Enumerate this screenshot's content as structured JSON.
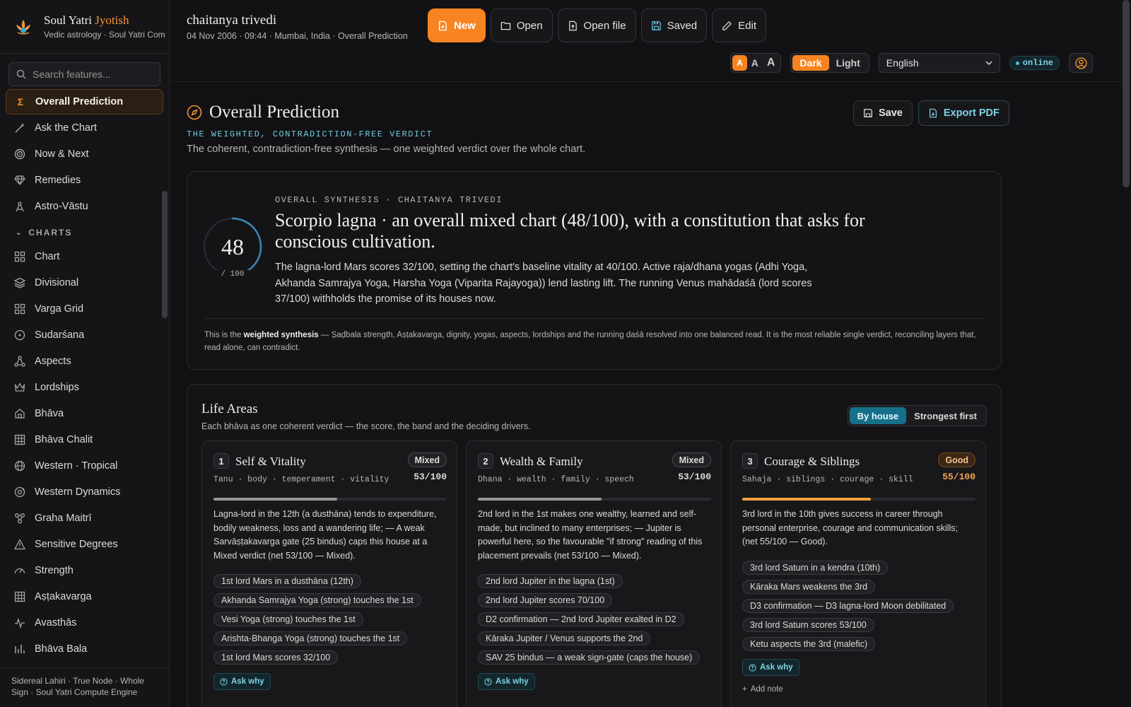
{
  "brand": {
    "title_main": "Soul Yatri ",
    "title_accent": "Jyotish",
    "subtitle": "Vedic astrology · Soul Yatri Com"
  },
  "search": {
    "placeholder": "Search features..."
  },
  "sidebar": {
    "top_items": [
      {
        "label": "Overall Prediction",
        "icon": "sigma-icon",
        "active": true
      },
      {
        "label": "Ask the Chart",
        "icon": "wand-icon"
      },
      {
        "label": "Now & Next",
        "icon": "target-icon"
      },
      {
        "label": "Remedies",
        "icon": "gem-icon"
      },
      {
        "label": "Astro-Vāstu",
        "icon": "compass-icon"
      }
    ],
    "section_label": "CHARTS",
    "chart_items": [
      {
        "label": "Chart",
        "icon": "grid-icon"
      },
      {
        "label": "Divisional",
        "icon": "layers-icon"
      },
      {
        "label": "Varga Grid",
        "icon": "grid-icon"
      },
      {
        "label": "Sudarśana",
        "icon": "circle-dot-icon"
      },
      {
        "label": "Aspects",
        "icon": "network-icon"
      },
      {
        "label": "Lordships",
        "icon": "crown-icon"
      },
      {
        "label": "Bhāva",
        "icon": "home-icon"
      },
      {
        "label": "Bhāva Chalit",
        "icon": "table-icon"
      },
      {
        "label": "Western · Tropical",
        "icon": "globe-icon"
      },
      {
        "label": "Western Dynamics",
        "icon": "orbit-icon"
      },
      {
        "label": "Graha Maitrī",
        "icon": "link-icon"
      },
      {
        "label": "Sensitive Degrees",
        "icon": "warning-icon"
      },
      {
        "label": "Strength",
        "icon": "gauge-icon"
      },
      {
        "label": "Aṣṭakavarga",
        "icon": "table-icon"
      },
      {
        "label": "Avasthās",
        "icon": "pulse-icon"
      },
      {
        "label": "Bhāva Bala",
        "icon": "bar-chart-icon"
      }
    ],
    "footer": "Sidereal Lahiri · True Node · Whole Sign · Soul Yatri Compute Engine"
  },
  "topbar": {
    "name": "chaitanya trivedi",
    "meta": "04 Nov 2006 · 09:44 · Mumbai, India  ·  Overall Prediction",
    "buttons": {
      "new": "New",
      "open": "Open",
      "open_file": "Open file",
      "saved": "Saved",
      "edit": "Edit"
    },
    "font_sizes": [
      "A",
      "A",
      "A"
    ],
    "theme": {
      "dark": "Dark",
      "light": "Light"
    },
    "language": "English",
    "status": "online"
  },
  "page": {
    "title": "Overall Prediction",
    "kicker": "THE WEIGHTED, CONTRADICTION-FREE VERDICT",
    "description": "The coherent, contradiction-free synthesis — one weighted verdict over the whole chart.",
    "save_label": "Save",
    "export_label": "Export PDF"
  },
  "synthesis": {
    "score": "48",
    "score_denominator": "/ 100",
    "score_value": 48,
    "kicker": "OVERALL SYNTHESIS · CHAITANYA TRIVEDI",
    "headline": "Scorpio lagna · an overall mixed chart (48/100), with a constitution that asks for conscious cultivation.",
    "body": "The lagna-lord Mars scores 32/100, setting the chart's baseline vitality at 40/100. Active raja/dhana yogas (Adhi Yoga, Akhanda Samrajya Yoga, Harsha Yoga (Viparita Rajayoga)) lend lasting lift. The running Venus mahādaśā (lord scores 37/100) withholds the promise of its houses now.",
    "note_prefix": "This is the ",
    "note_bold": "weighted synthesis",
    "note_suffix": " — Ṣaḍbala strength, Aṣṭakavarga, dignity, yogas, aspects, lordships and the running daśā resolved into one balanced read. It is the most reliable single verdict, reconciling layers that, read alone, can contradict."
  },
  "life_areas": {
    "title": "Life Areas",
    "subtitle": "Each bhāva as one coherent verdict — the score, the band and the deciding drivers.",
    "toggle": {
      "by_house": "By house",
      "strongest": "Strongest first"
    },
    "ask_label": "Ask why",
    "add_note_label": "Add note",
    "cards": [
      {
        "num": "1",
        "title": "Self & Vitality",
        "tags": "Tanu · body · temperament · vitality",
        "band": "Mixed",
        "score_text": "53/100",
        "score": 53,
        "text": "Lagna-lord in the 12th (a dusthāna) tends to expenditure, bodily weakness, loss and a wandering life; — A weak Sarvāṣṭakavarga gate (25 bindus) caps this house at a Mixed verdict (net 53/100 — Mixed).",
        "chips": [
          "1st lord Mars in a dusthāna (12th)",
          "Akhanda Samrajya Yoga (strong) touches the 1st",
          "Vesi Yoga (strong) touches the 1st",
          "Arishta-Bhanga Yoga (strong) touches the 1st",
          "1st lord Mars scores 32/100"
        ]
      },
      {
        "num": "2",
        "title": "Wealth & Family",
        "tags": "Dhana · wealth · family · speech",
        "band": "Mixed",
        "score_text": "53/100",
        "score": 53,
        "text": "2nd lord in the 1st makes one wealthy, learned and self-made, but inclined to many enterprises; — Jupiter is powerful here, so the favourable \"if strong\" reading of this placement prevails (net 53/100 — Mixed).",
        "chips": [
          "2nd lord Jupiter in the lagna (1st)",
          "2nd lord Jupiter scores 70/100",
          "D2 confirmation — 2nd lord Jupiter exalted in D2",
          "Kāraka Jupiter / Venus supports the 2nd",
          "SAV 25 bindus — a weak sign-gate (caps the house)"
        ]
      },
      {
        "num": "3",
        "title": "Courage & Siblings",
        "tags": "Sahaja · siblings · courage · skill",
        "band": "Good",
        "score_text": "55/100",
        "score": 55,
        "text": "3rd lord in the 10th gives success in career through personal enterprise, courage and communication skills; (net 55/100 — Good).",
        "chips": [
          "3rd lord Saturn in a kendra (10th)",
          "Kāraka Mars weakens the 3rd",
          "D3 confirmation — D3 lagna-lord Moon debilitated",
          "3rd lord Saturn scores 53/100",
          "Ketu aspects the 3rd (malefic)"
        ]
      }
    ]
  },
  "colors": {
    "accent": "#f88421",
    "cyan": "#6fcbe0",
    "bg": "#111114",
    "good": "#f2a03d",
    "gauge": "#3b87b8"
  }
}
